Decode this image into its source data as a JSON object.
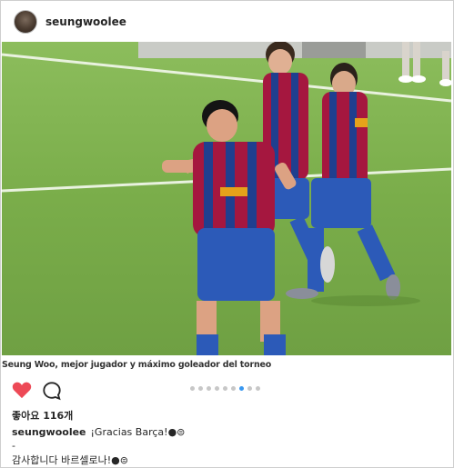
{
  "header": {
    "username": "seungwoolee",
    "avatar_icon": "profile-avatar"
  },
  "photo": {
    "caption": "Seung Woo, mejor jugador y máximo goleador del torneo",
    "shirt_colors": [
      "#1f3f8f",
      "#a5173f"
    ],
    "pitch_color": "#7fb04a"
  },
  "actions": {
    "like_icon": "heart-icon",
    "like_color": "#ed4956",
    "comment_icon": "comment-bubble-icon",
    "carousel_total": 9,
    "carousel_active": 7
  },
  "likes": {
    "text": "좋아요 116개"
  },
  "caption": {
    "user": "seungwoolee",
    "line1": "¡Gracias Barça!",
    "line1_emoji": "●⊜",
    "line2": "-",
    "line3": "감사합니다 바르셀로나!",
    "line3_emoji": "●⊜"
  }
}
